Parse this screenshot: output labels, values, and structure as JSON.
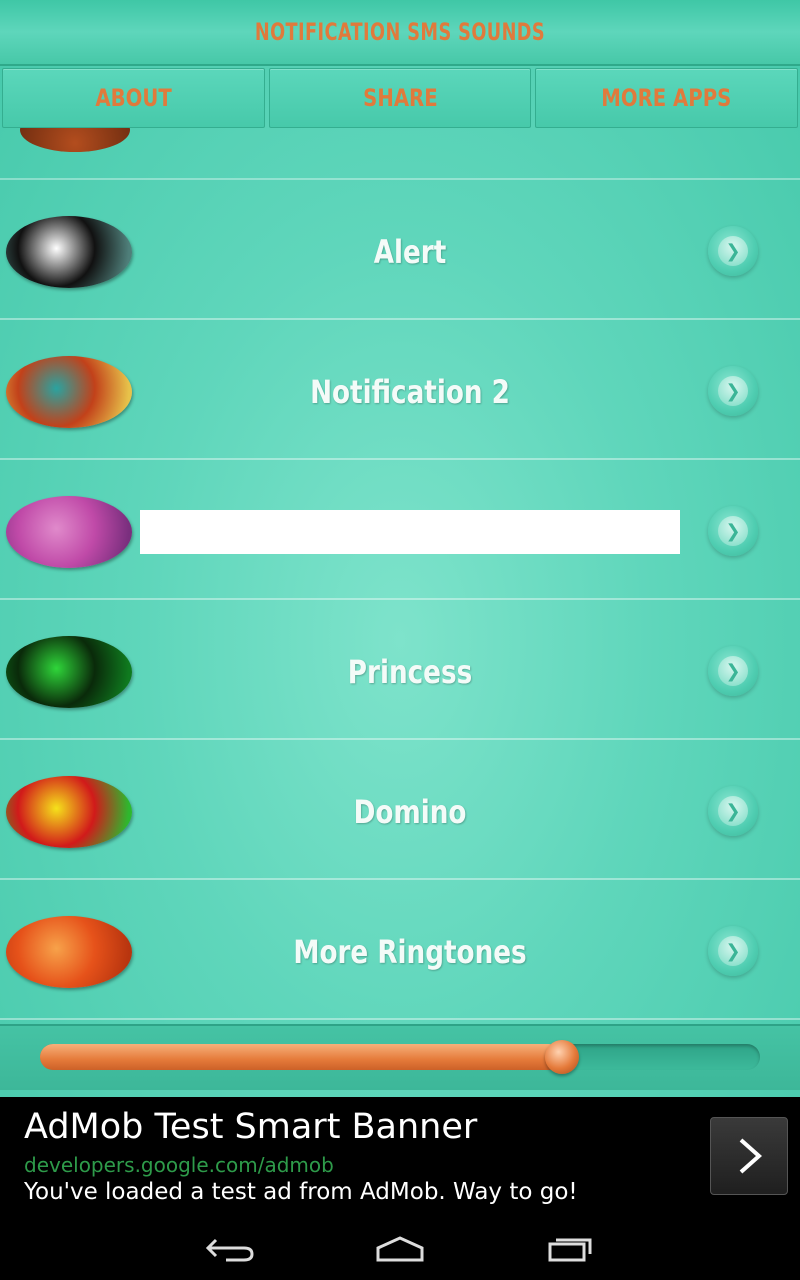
{
  "header": {
    "title": "NOTIFICATION SMS SOUNDS"
  },
  "nav": {
    "about": "ABOUT",
    "share": "SHARE",
    "more_apps": "MORE APPS"
  },
  "list": {
    "items": [
      {
        "label": "Alert",
        "thumb_colors": [
          "#111111",
          "#ffffff",
          "#4f7f7a"
        ]
      },
      {
        "label": "Notification 2",
        "thumb_colors": [
          "#c2411a",
          "#2aa3a0",
          "#e7c24a"
        ]
      },
      {
        "label": "",
        "thumb_colors": [
          "#c04aa8",
          "#e08acb",
          "#7a2f7e"
        ]
      },
      {
        "label": "Princess",
        "thumb_colors": [
          "#0a2a0a",
          "#2fd63a",
          "#0f7a1f"
        ]
      },
      {
        "label": "Domino",
        "thumb_colors": [
          "#d11a1a",
          "#f5e21b",
          "#2eb82e"
        ]
      },
      {
        "label": "More Ringtones",
        "thumb_colors": [
          "#e6521a",
          "#f7a24a",
          "#b8350f"
        ]
      }
    ]
  },
  "player": {
    "progress": 0.725
  },
  "ad": {
    "title": "AdMob Test Smart Banner",
    "url": "developers.google.com/admob",
    "description": "You've loaded a test ad from AdMob. Way to go!"
  },
  "colors": {
    "accent": "#e07a3c",
    "teal": "#55d2b6"
  }
}
